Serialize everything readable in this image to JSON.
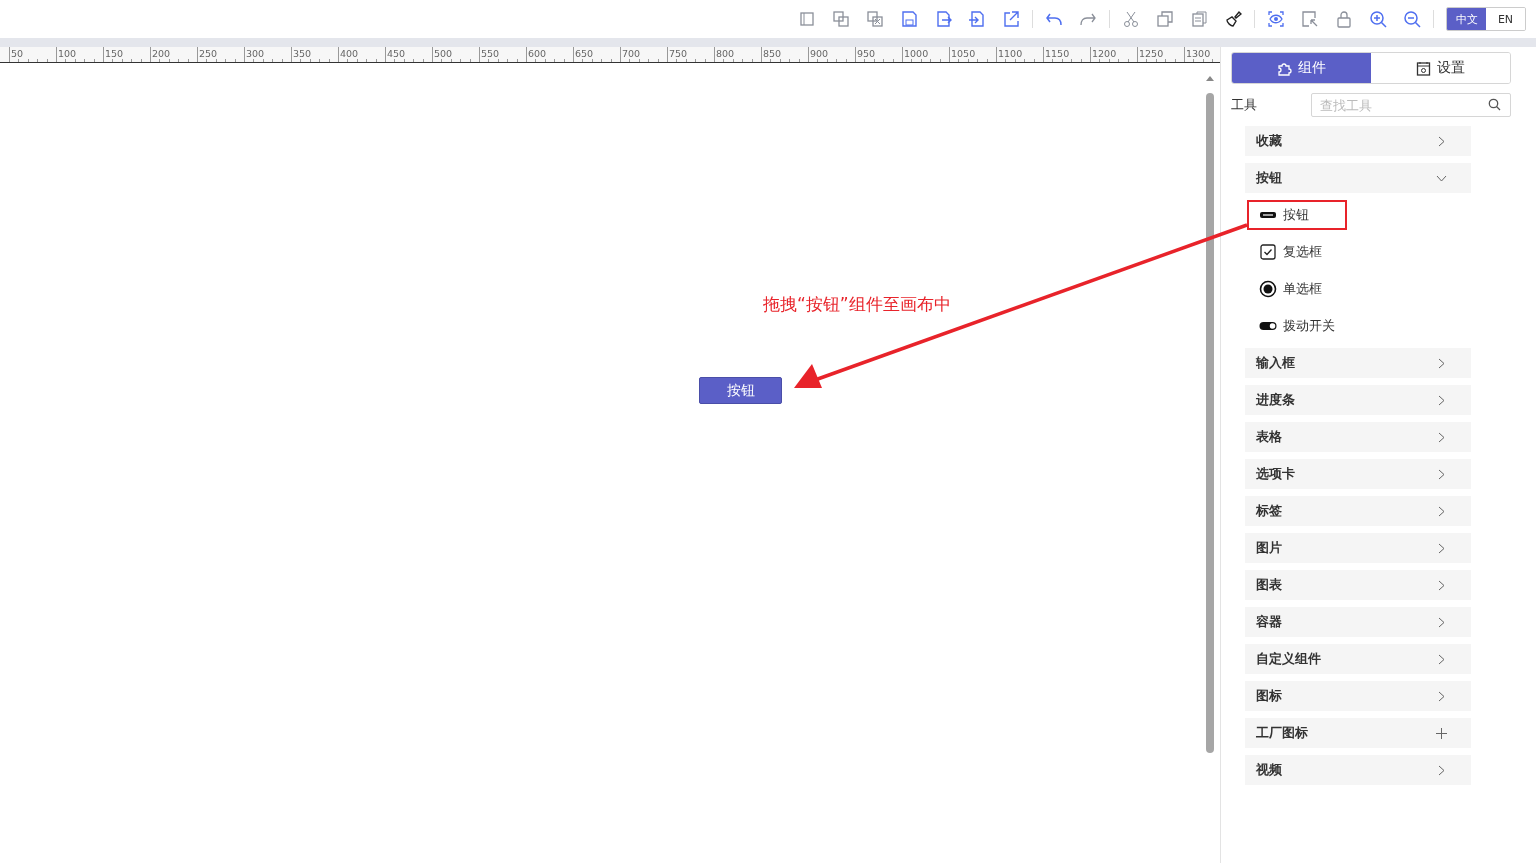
{
  "language_switch": [
    {
      "label": "中文",
      "selected": true
    },
    {
      "label": "EN",
      "selected": false
    }
  ],
  "ruler": [
    "50",
    "100",
    "150",
    "200",
    "250",
    "300",
    "350",
    "400",
    "450",
    "500",
    "550",
    "600",
    "650",
    "700",
    "750",
    "800",
    "850",
    "900",
    "950",
    "1000",
    "1050",
    "1100",
    "1150",
    "1200",
    "1250",
    "1300"
  ],
  "canvas": {
    "annotation": "拖拽“按钮”组件至画布中",
    "placed_button": "按钮"
  },
  "panel": {
    "tabs": [
      {
        "label": "组件",
        "kind": "puzzle",
        "selected": true
      },
      {
        "label": "设置",
        "kind": "calendar",
        "selected": false
      }
    ],
    "tools_label": "工具",
    "search": {
      "placeholder": "查找工具"
    },
    "categories": [
      {
        "label": "收藏",
        "kind": "group",
        "expanded": false
      },
      {
        "label": "按钮",
        "kind": "group",
        "expanded": true,
        "children": [
          {
            "label": "按钮",
            "kind": "button",
            "highlighted": true
          },
          {
            "label": "复选框",
            "kind": "checkbox",
            "highlighted": false
          },
          {
            "label": "单选框",
            "kind": "radio",
            "highlighted": false
          },
          {
            "label": "拨动开关",
            "kind": "switch",
            "highlighted": false
          }
        ]
      },
      {
        "label": "输入框",
        "kind": "group",
        "expanded": false
      },
      {
        "label": "进度条",
        "kind": "group",
        "expanded": false
      },
      {
        "label": "表格",
        "kind": "group",
        "expanded": false
      },
      {
        "label": "选项卡",
        "kind": "group",
        "expanded": false
      },
      {
        "label": "标签",
        "kind": "group",
        "expanded": false
      },
      {
        "label": "图片",
        "kind": "group",
        "expanded": false
      },
      {
        "label": "图表",
        "kind": "group",
        "expanded": false
      },
      {
        "label": "容器",
        "kind": "group",
        "expanded": false
      },
      {
        "label": "自定义组件",
        "kind": "group",
        "expanded": false
      },
      {
        "label": "图标",
        "kind": "group",
        "expanded": false
      },
      {
        "label": "工厂图标",
        "kind": "add"
      },
      {
        "label": "视频",
        "kind": "group",
        "expanded": false
      }
    ]
  }
}
